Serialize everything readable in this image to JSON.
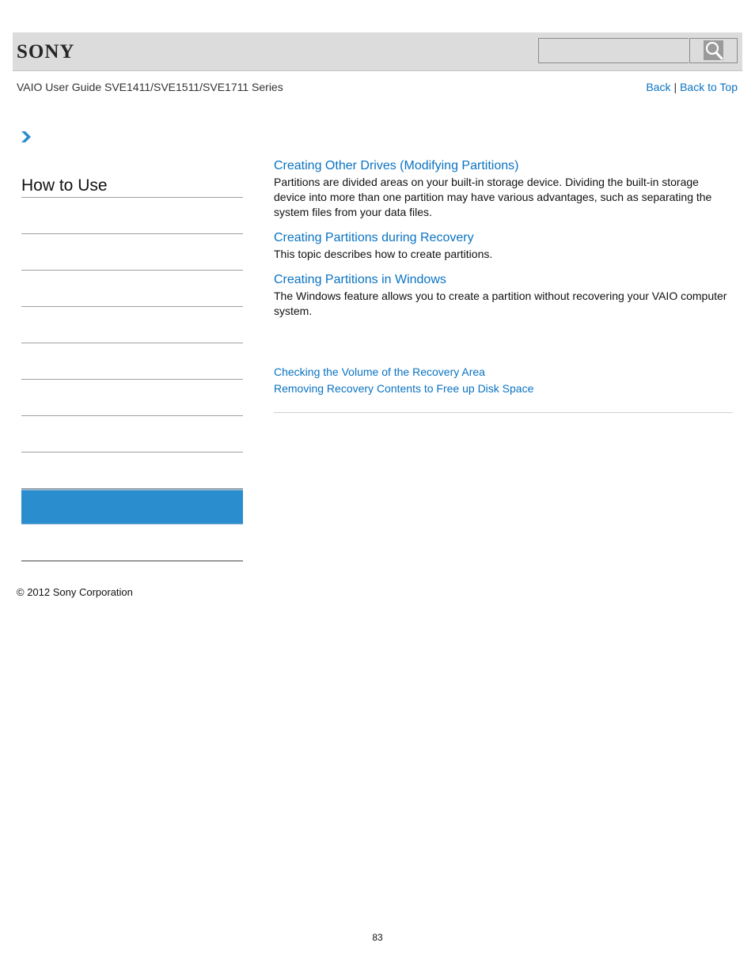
{
  "header": {
    "brand": "SONY",
    "search": {
      "placeholder": "",
      "value": ""
    },
    "search_icon": "magnifier-icon"
  },
  "subheader": {
    "guide_title": "VAIO User Guide SVE1411/SVE1511/SVE1711 Series",
    "back_label": "Back",
    "separator": "|",
    "back_to_top_label": "Back to Top"
  },
  "breadcrumb": {
    "icon": "chevron-right-icon"
  },
  "sidebar": {
    "title": "How to Use",
    "items": [
      {
        "label": "",
        "active": false
      },
      {
        "label": "",
        "active": false
      },
      {
        "label": "",
        "active": false
      },
      {
        "label": "",
        "active": false
      },
      {
        "label": "",
        "active": false
      },
      {
        "label": "",
        "active": false
      },
      {
        "label": "",
        "active": false
      },
      {
        "label": "",
        "active": false
      },
      {
        "label": "",
        "active": true
      },
      {
        "label": "",
        "active": false
      }
    ]
  },
  "colors": {
    "link": "#0a73c2",
    "active_item": "#2a8dce",
    "header_bg": "#dcdcdc"
  },
  "main": {
    "topics": [
      {
        "title": "Creating Other Drives (Modifying Partitions)",
        "description": "Partitions are divided areas on your built-in storage device. Dividing the built-in storage device into more than one partition may have various advantages, such as separating the system files from your data files."
      },
      {
        "title": "Creating Partitions during Recovery",
        "description": "This topic describes how to create partitions."
      },
      {
        "title": "Creating Partitions in Windows",
        "description": "The Windows feature allows you to create a partition without recovering your VAIO computer system."
      }
    ],
    "related_links": [
      "Checking the Volume of the Recovery Area",
      "Removing Recovery Contents to Free up Disk Space"
    ]
  },
  "footer": {
    "copyright": "© 2012 Sony Corporation",
    "page_number": "83"
  }
}
